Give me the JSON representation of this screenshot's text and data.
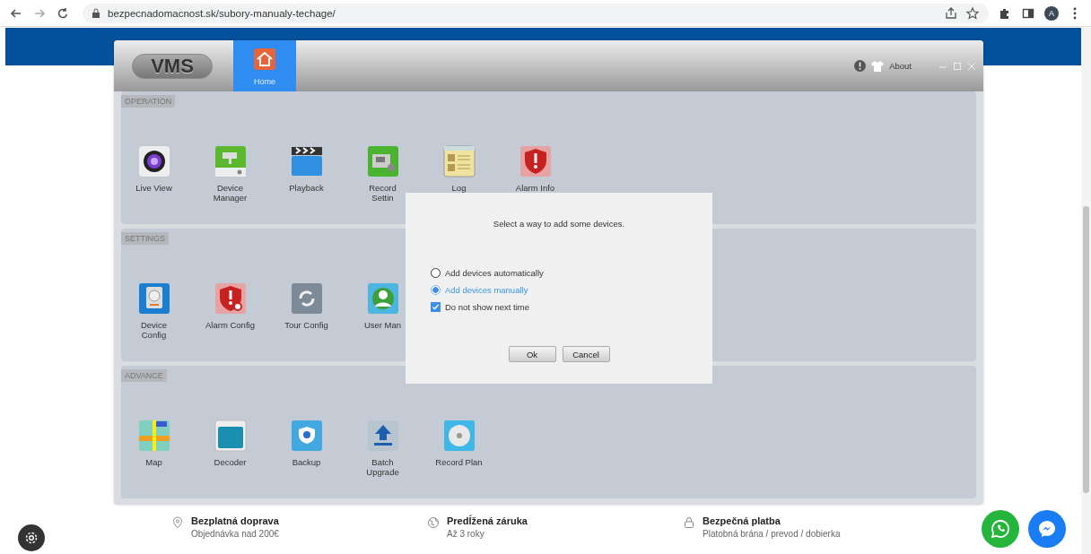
{
  "browser": {
    "url": "bezpecnadomacnost.sk/subory-manualy-techage/",
    "profile": "A"
  },
  "vms": {
    "logo": "VMS",
    "tabs": [
      {
        "label": "Home",
        "selected": true
      }
    ],
    "about": "About",
    "sections": [
      {
        "title": "OPERATION",
        "items": [
          {
            "label": "Live View"
          },
          {
            "label": "Device\nManager"
          },
          {
            "label": "Playback"
          },
          {
            "label": "Record\nSettin"
          },
          {
            "label": "Log"
          },
          {
            "label": "Alarm Info"
          }
        ]
      },
      {
        "title": "SETTINGS",
        "items": [
          {
            "label": "Device\nConfig"
          },
          {
            "label": "Alarm Config"
          },
          {
            "label": "Tour Config"
          },
          {
            "label": "User Man"
          }
        ]
      },
      {
        "title": "ADVANCE",
        "items": [
          {
            "label": "Map"
          },
          {
            "label": "Decoder"
          },
          {
            "label": "Backup"
          },
          {
            "label": "Batch\nUpgrade"
          },
          {
            "label": "Record Plan"
          }
        ]
      }
    ],
    "dialog": {
      "message": "Select a way to add some devices.",
      "options": [
        {
          "label": "Add devices automatically",
          "selected": false
        },
        {
          "label": "Add devices manually",
          "selected": true
        }
      ],
      "checkbox": {
        "label": "Do not show next time",
        "checked": true
      },
      "buttons": [
        "Ok",
        "Cancel"
      ]
    }
  },
  "footer": {
    "features": [
      {
        "title": "Bezplatná doprava",
        "subtitle": "Objednávka nad 200€"
      },
      {
        "title": "Predĺžená záruka",
        "subtitle": "Až 3 roky"
      },
      {
        "title": "Bezpečná platba",
        "subtitle": "Platobná brána / prevod / dobierka"
      }
    ]
  }
}
